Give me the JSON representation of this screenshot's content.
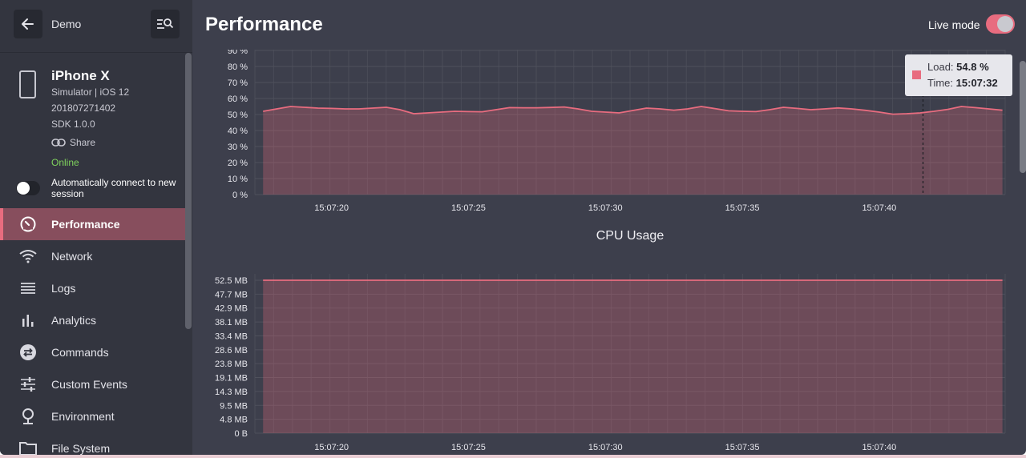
{
  "sidebar": {
    "title": "Demo",
    "device": {
      "name": "iPhone X",
      "details": "Simulator | iOS 12",
      "build": "201807271402",
      "sdk": "SDK 1.0.0",
      "share_label": "Share",
      "status": "Online"
    },
    "auto_connect_label": "Automatically connect to new session",
    "auto_connect_enabled": false,
    "nav": [
      {
        "label": "Performance",
        "icon": "gauge-icon",
        "active": true
      },
      {
        "label": "Network",
        "icon": "wifi-icon",
        "active": false
      },
      {
        "label": "Logs",
        "icon": "list-icon",
        "active": false
      },
      {
        "label": "Analytics",
        "icon": "bar-chart-icon",
        "active": false
      },
      {
        "label": "Commands",
        "icon": "swap-icon",
        "active": false
      },
      {
        "label": "Custom Events",
        "icon": "sliders-icon",
        "active": false
      },
      {
        "label": "Environment",
        "icon": "pin-icon",
        "active": false
      },
      {
        "label": "File System",
        "icon": "folder-icon",
        "active": false
      }
    ]
  },
  "header": {
    "title": "Performance",
    "live_mode_label": "Live mode",
    "live_mode_enabled": true
  },
  "tooltip": {
    "load_label": "Load:",
    "load_value": "54.8 %",
    "time_label": "Time:",
    "time_value": "15:07:32"
  },
  "colors": {
    "accent": "#e86c7f",
    "background": "#3d3f4c",
    "sidebar": "#33353f",
    "active_nav": "#874e5d",
    "online": "#7fd25d"
  },
  "chart_data": [
    {
      "type": "area",
      "title": "",
      "ylabel": "",
      "yticks": [
        "0 %",
        "10 %",
        "20 %",
        "30 %",
        "40 %",
        "50 %",
        "60 %",
        "70 %",
        "80 %",
        "90 %"
      ],
      "ylim": [
        0,
        90
      ],
      "xticks": [
        "15:07:20",
        "15:07:25",
        "15:07:30",
        "15:07:35",
        "15:07:40"
      ],
      "x_seconds": [
        17.5,
        18.0,
        18.5,
        19.0,
        19.5,
        20.0,
        20.5,
        21.0,
        21.5,
        22.0,
        22.5,
        23.0,
        23.5,
        24.0,
        24.5,
        25.0,
        25.5,
        26.0,
        26.5,
        27.0,
        27.5,
        28.0,
        28.5,
        29.0,
        29.5,
        30.0,
        30.5,
        31.0,
        31.5,
        32.0,
        32.5,
        33.0,
        33.5,
        34.0,
        34.5,
        35.0,
        35.5,
        36.0,
        36.5,
        37.0,
        37.5,
        38.0,
        38.5,
        39.0,
        39.5,
        40.0,
        40.5,
        41.0,
        41.5,
        42.0,
        42.5,
        43.0,
        43.5,
        44.0,
        44.5
      ],
      "values": [
        52,
        53.5,
        55,
        54.5,
        54,
        53.8,
        53.5,
        53.5,
        54,
        54.5,
        53,
        50.5,
        51,
        51.5,
        52,
        51.8,
        51.7,
        53,
        54.3,
        54.2,
        54.2,
        54.4,
        54.7,
        53.5,
        52,
        51.5,
        51,
        52.5,
        54,
        53.5,
        52.7,
        53.5,
        55,
        53.7,
        52.3,
        52,
        51.8,
        53,
        54.5,
        53.8,
        53,
        53.5,
        54.1,
        53.5,
        52.6,
        51.5,
        50.2,
        50.5,
        51,
        52,
        53.2,
        55,
        54.3,
        53.5,
        52.7
      ],
      "highlight_x": 41.6,
      "grid": true
    },
    {
      "type": "area",
      "title": "CPU Usage",
      "ylabel": "",
      "yticks": [
        "0 B",
        "4.8 MB",
        "9.5 MB",
        "14.3 MB",
        "19.1 MB",
        "23.8 MB",
        "28.6 MB",
        "33.4 MB",
        "38.1 MB",
        "42.9 MB",
        "47.7 MB",
        "52.5 MB"
      ],
      "ylim": [
        0,
        52.5
      ],
      "xticks": [
        "15:07:20",
        "15:07:25",
        "15:07:30",
        "15:07:35",
        "15:07:40"
      ],
      "x_seconds": [
        17.5,
        44.5
      ],
      "values": [
        52.5,
        52.5
      ],
      "grid": true
    }
  ]
}
